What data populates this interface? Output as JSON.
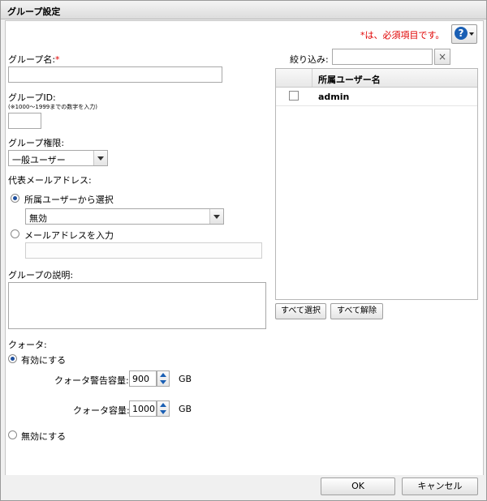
{
  "window": {
    "title": "グループ設定"
  },
  "header": {
    "required_note": "*は、必須項目です。",
    "help_glyph": "?"
  },
  "form": {
    "group_name": {
      "label": "グループ名:",
      "required_mark": "*",
      "value": ""
    },
    "group_id": {
      "label": "グループID:",
      "hint": "(※1000～1999までの数字を入力)",
      "value": ""
    },
    "group_privilege": {
      "label": "グループ権限:",
      "selected": "一般ユーザー"
    },
    "email": {
      "label": "代表メールアドレス:",
      "option_select": "所属ユーザーから選択",
      "select_value": "無効",
      "option_input": "メールアドレスを入力",
      "input_value": ""
    },
    "description": {
      "label": "グループの説明:",
      "value": ""
    },
    "quota": {
      "label": "クォータ:",
      "enable_label": "有効にする",
      "warning_label": "クォータ警告容量:",
      "warning_value": "900",
      "capacity_label": "クォータ容量:",
      "capacity_value": "1000",
      "unit": "GB",
      "disable_label": "無効にする"
    }
  },
  "filter": {
    "label": "絞り込み:",
    "value": "",
    "clear_glyph": "×"
  },
  "user_table": {
    "column_header": "所属ユーザー名",
    "rows": [
      {
        "name": "admin",
        "checked": false
      }
    ]
  },
  "table_buttons": {
    "select_all": "すべて選択",
    "clear_all": "すべて解除"
  },
  "footer": {
    "ok": "OK",
    "cancel": "キャンセル"
  },
  "colors": {
    "accent": "#1a5fb4",
    "required": "#e00000"
  }
}
